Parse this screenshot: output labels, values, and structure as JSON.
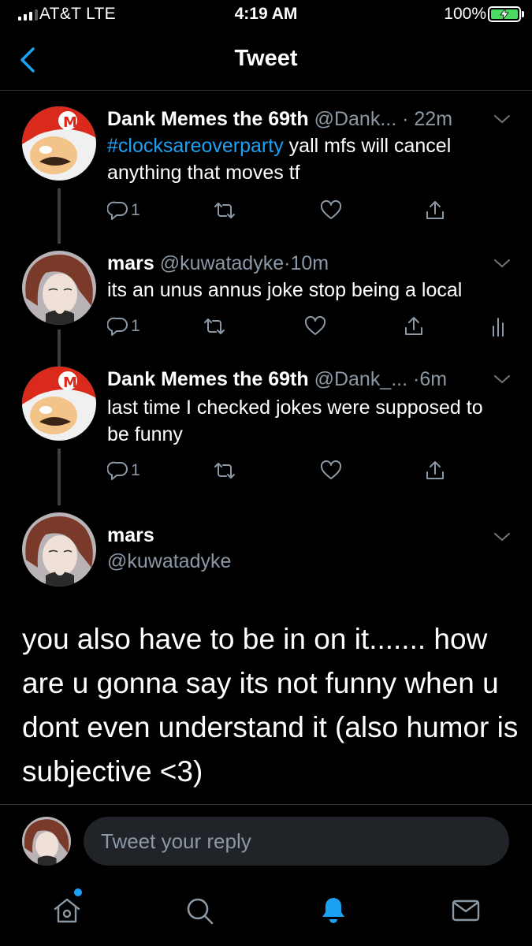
{
  "status_bar": {
    "carrier": "AT&T  LTE",
    "time": "4:19 AM",
    "battery": "100%"
  },
  "header": {
    "title": "Tweet"
  },
  "tweets": [
    {
      "name": "Dank Memes the 69th",
      "handle": "@Dank...",
      "time": "22m",
      "hashtag": "#clocksareoverparty",
      "text": " yall mfs will cancel anything that moves tf",
      "reply_count": "1"
    },
    {
      "name": "mars",
      "handle": "@kuwatadyke",
      "time": "10m",
      "text": "its an unus annus joke stop being a local",
      "reply_count": "1"
    },
    {
      "name": "Dank Memes the 69th",
      "handle": "@Dank_...",
      "time": "6m",
      "text": "last time I checked jokes were supposed to be funny",
      "reply_count": "1"
    }
  ],
  "main_tweet": {
    "name": "mars",
    "handle": "@kuwatadyke",
    "text": "you also have to be in on it....... how are u gonna say its not funny when u dont even understand it (also humor is subjective <3)"
  },
  "reply": {
    "placeholder": "Tweet your reply"
  },
  "tab_bar": {
    "items": [
      "home-icon",
      "search-icon",
      "notifications-icon",
      "messages-icon"
    ],
    "active": "notifications-icon"
  },
  "colors": {
    "accent": "#1da1f2",
    "muted": "#8b98a5",
    "background": "#000000",
    "battery": "#4cd964"
  }
}
